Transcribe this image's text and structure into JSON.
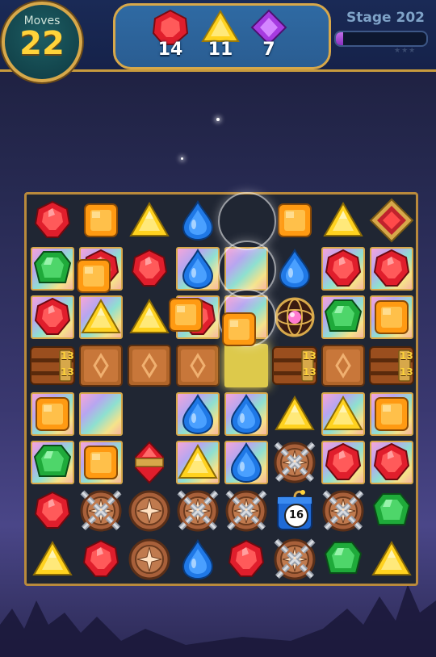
{
  "header": {
    "moves_label": "Moves",
    "moves_value": "22",
    "stage_label": "Stage 202",
    "stage_progress": 0.08
  },
  "goals": [
    {
      "gem": "red",
      "count": "14"
    },
    {
      "gem": "yellow",
      "count": "11"
    },
    {
      "gem": "purple",
      "count": "7"
    }
  ],
  "board": {
    "rows": 8,
    "cols": 8,
    "cells": [
      [
        "red",
        "orange",
        "yellow",
        "blue",
        "empty-spark",
        "orange",
        "yellow",
        "red-diamond-tile"
      ],
      [
        "green-on-bonus",
        "red-on-bonus",
        "red",
        "blue-on-bonus",
        "bonus",
        "blue",
        "red-on-bonus",
        "red-on-bonus"
      ],
      [
        "red-on-bonus",
        "yellow-on-bonus",
        "yellow",
        "red-on-bonus",
        "bonus",
        "rainbow-orb",
        "green-on-bonus",
        "orange-on-bonus"
      ],
      [
        "chest",
        "crate",
        "crate",
        "crate",
        "glow-tile",
        "chest",
        "crate",
        "chest"
      ],
      [
        "orange-on-bonus",
        "bonus",
        "empty",
        "blue-on-bonus",
        "blue-on-bonus",
        "yellow",
        "yellow-on-bonus",
        "orange-on-bonus"
      ],
      [
        "green-on-bonus",
        "orange-on-bonus",
        "red-striped",
        "yellow-on-bonus",
        "blue-on-bonus",
        "chained-compass",
        "red-on-bonus",
        "red-on-bonus"
      ],
      [
        "red",
        "chained-compass",
        "compass",
        "chained-compass",
        "chained-compass",
        "bomb",
        "chained-compass",
        "green"
      ],
      [
        "yellow",
        "red",
        "compass",
        "blue",
        "red",
        "chained-compass",
        "green",
        "yellow"
      ]
    ],
    "chest_counter": "13",
    "bomb_counter": "16"
  },
  "colors": {
    "red": "#e01e2c",
    "orange": "#ff9a12",
    "yellow": "#ffd21f",
    "blue": "#1f78e6",
    "green": "#1faa3a",
    "purple": "#a63be0",
    "frame_gold": "#d7a84a"
  }
}
